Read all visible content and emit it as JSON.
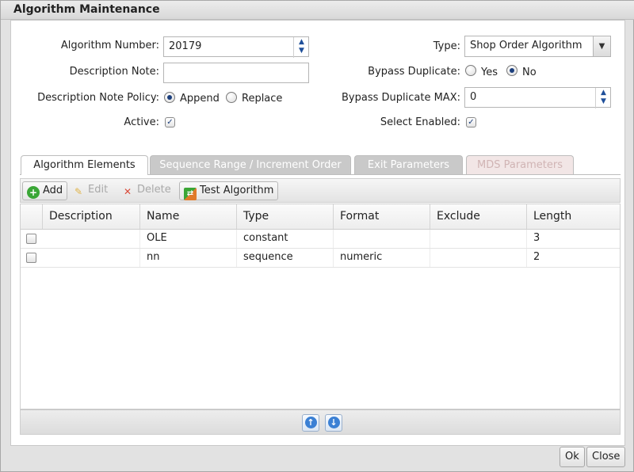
{
  "dialog": {
    "title": "Algorithm Maintenance"
  },
  "form": {
    "algorithm_number_label": "Algorithm Number:",
    "algorithm_number_value": "20179",
    "description_note_label": "Description Note:",
    "description_note_value": "",
    "description_note_policy_label": "Description Note Policy:",
    "policy_options": [
      "Append",
      "Replace"
    ],
    "policy_selected": "Append",
    "active_label": "Active:",
    "active_checked": true,
    "type_label": "Type:",
    "type_value": "Shop Order Algorithm",
    "bypass_duplicate_label": "Bypass Duplicate:",
    "bypass_options": [
      "Yes",
      "No"
    ],
    "bypass_selected": "No",
    "bypass_duplicate_max_label": "Bypass Duplicate MAX:",
    "bypass_duplicate_max_value": "0",
    "select_enabled_label": "Select Enabled:",
    "select_enabled_checked": true
  },
  "tabs": [
    {
      "label": "Algorithm Elements",
      "state": "active"
    },
    {
      "label": "Sequence Range / Increment Order",
      "state": "inactive"
    },
    {
      "label": "Exit Parameters",
      "state": "inactive"
    },
    {
      "label": "MDS Parameters",
      "state": "disabled"
    }
  ],
  "toolbar": {
    "add_label": "Add",
    "edit_label": "Edit",
    "delete_label": "Delete",
    "test_label": "Test Algorithm"
  },
  "grid": {
    "columns": [
      "Description",
      "Name",
      "Type",
      "Format",
      "Exclude",
      "Length"
    ],
    "rows": [
      [
        "",
        "OLE",
        "constant",
        "",
        "",
        "3"
      ],
      [
        "",
        "nn",
        "sequence",
        "numeric",
        "",
        "2"
      ]
    ]
  },
  "buttons": {
    "ok_label": "Ok",
    "close_label": "Close"
  },
  "colors": {
    "accent": "#1c3f7d",
    "nav_blue": "#3b80d4",
    "add_green": "#3aa636"
  }
}
